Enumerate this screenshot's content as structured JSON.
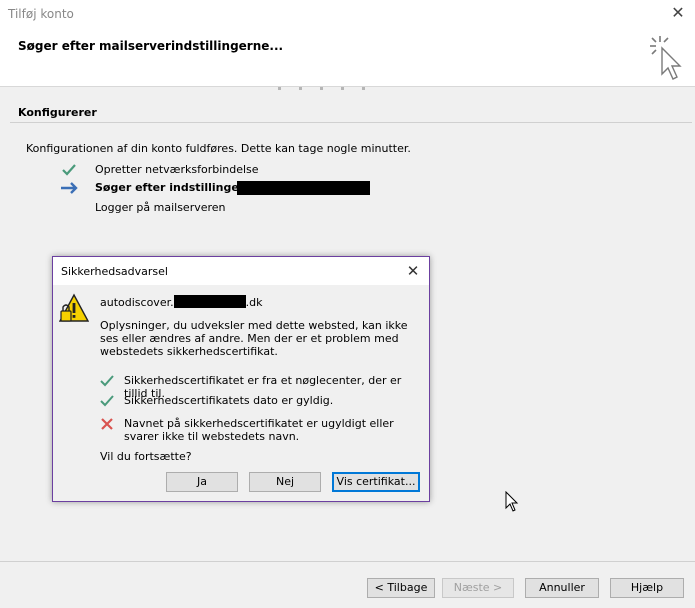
{
  "window": {
    "title": "Tilføj konto",
    "header": "Søger efter mailserverindstillingerne..."
  },
  "section": {
    "title": "Konfigurerer",
    "intro": "Konfigurationen af din konto fuldføres. Dette kan tage nogle minutter.",
    "steps": [
      {
        "label": "Opretter netværksforbindelse",
        "state": "done",
        "icon": "check-icon"
      },
      {
        "label": "Søger efter indstillinger for",
        "state": "active",
        "icon": "arrow-right-icon"
      },
      {
        "label": "Logger på mailserveren",
        "state": "pending",
        "icon": ""
      }
    ]
  },
  "dialog": {
    "title": "Sikkerhedsadvarsel",
    "host_prefix": "autodiscover.",
    "host_suffix": ".dk",
    "description": "Oplysninger, du udveksler med dette websted, kan ikke ses eller ændres af andre. Men der er et problem med webstedets sikkerhedscertifikat.",
    "checks": [
      {
        "label": "Sikkerhedscertifikatet er fra et nøglecenter, der er tillid til.",
        "status": "ok",
        "icon": "check-icon"
      },
      {
        "label": "Sikkerhedscertifikatets dato er gyldig.",
        "status": "ok",
        "icon": "check-icon"
      },
      {
        "label": "Navnet på sikkerhedscertifikatet er ugyldigt eller svarer ikke til webstedets navn.",
        "status": "error",
        "icon": "x-icon"
      }
    ],
    "question": "Vil du fortsætte?",
    "buttons": {
      "yes": "Ja",
      "no": "Nej",
      "view_cert": "Vis certifikat..."
    }
  },
  "footer": {
    "back": "< Tilbage",
    "next": "Næste >",
    "cancel": "Annuller",
    "help": "Hjælp"
  },
  "colors": {
    "check": "#4a9a7b",
    "arrow": "#3b6fb6",
    "error": "#d9534f",
    "dialog_border": "#6b3fa0",
    "default_button_border": "#0078d7"
  }
}
